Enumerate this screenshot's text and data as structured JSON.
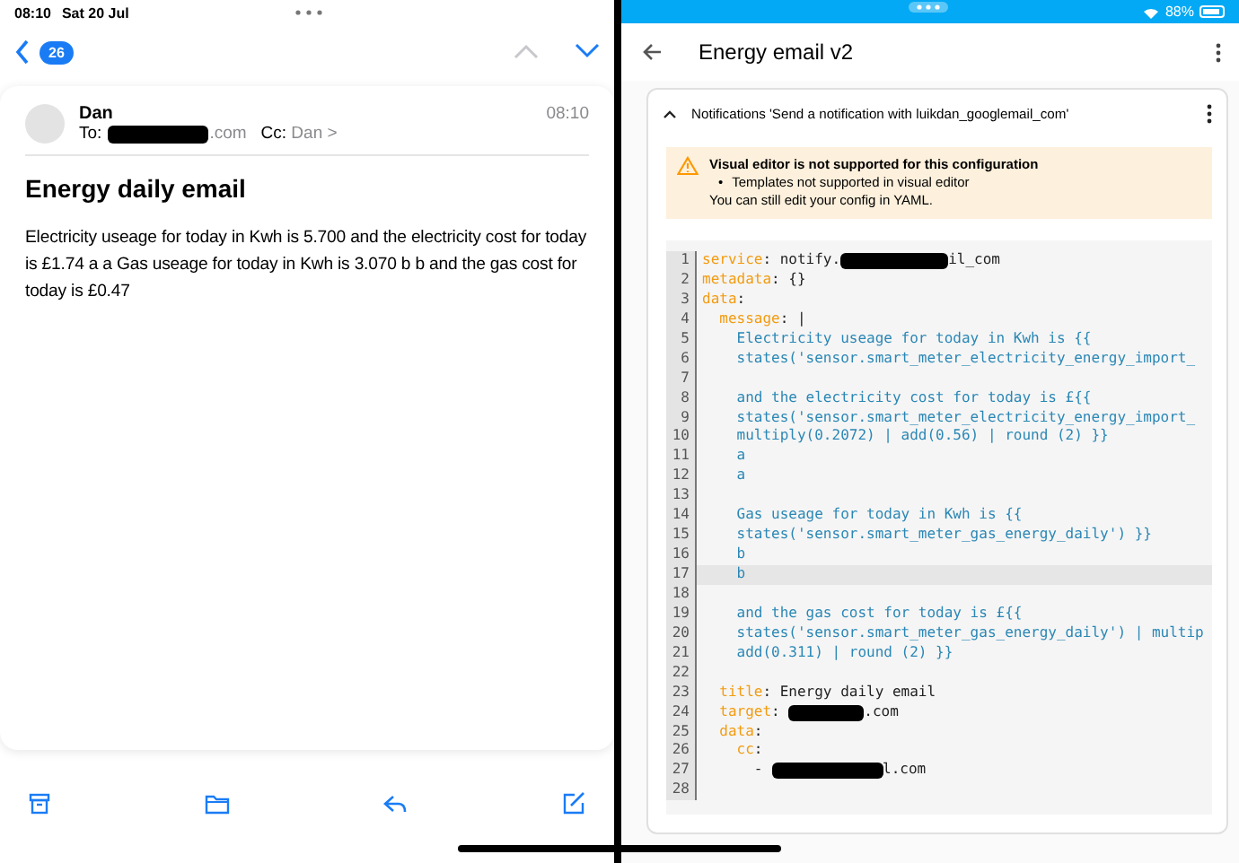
{
  "mail": {
    "status_bar": {
      "time": "08:10",
      "date": "Sat 20 Jul"
    },
    "nav": {
      "unread_count": "26",
      "previous_disabled": true,
      "next_disabled": false
    },
    "message": {
      "sender": "Dan",
      "to_label": "To:",
      "to_visible": ".com",
      "cc_label": "Cc:",
      "cc": "Dan",
      "cc_chevron": ">",
      "time": "08:10",
      "subject": "Energy daily email",
      "body": "Electricity useage for today in Kwh is 5.700 and the electricity cost for today is £1.74 a a Gas useage for today in Kwh is 3.070 b b and the gas cost for today is £0.47"
    }
  },
  "editor": {
    "status_bar": {
      "battery": "88%"
    },
    "title": "Energy email v2",
    "action": {
      "expanded": true,
      "title": "Notifications 'Send a notification with luikdan_googlemail_com'"
    },
    "warning": {
      "title": "Visual editor is not supported for this configuration",
      "bullets": [
        {
          "marker": "•",
          "text": "Templates not supported in visual editor"
        }
      ],
      "note": "You can still edit your config in YAML."
    },
    "code_lines": [
      {
        "number": "1",
        "active": false,
        "segments": [
          {
            "kind": "key",
            "text": "service"
          },
          {
            "kind": "plain",
            "text": ": notify."
          },
          {
            "kind": "redacted"
          },
          {
            "kind": "plain",
            "text": "il_com"
          }
        ]
      },
      {
        "number": "2",
        "active": false,
        "segments": [
          {
            "kind": "key",
            "text": "metadata"
          },
          {
            "kind": "plain",
            "text": ": {}"
          }
        ]
      },
      {
        "number": "3",
        "active": false,
        "segments": [
          {
            "kind": "key",
            "text": "data"
          },
          {
            "kind": "plain",
            "text": ":"
          }
        ]
      },
      {
        "number": "4",
        "active": false,
        "segments": [
          {
            "kind": "key",
            "text": "  message"
          },
          {
            "kind": "plain",
            "text": ": |"
          }
        ]
      },
      {
        "number": "5",
        "active": false,
        "segments": [
          {
            "kind": "string",
            "text": "    Electricity useage for today in Kwh is {{"
          }
        ]
      },
      {
        "number": "6",
        "active": false,
        "segments": [
          {
            "kind": "string",
            "text": "    states('sensor.smart_meter_electricity_energy_import_"
          }
        ]
      },
      {
        "number": "7",
        "active": false
      },
      {
        "number": "8",
        "active": false,
        "segments": [
          {
            "kind": "string",
            "text": "    and the electricity cost for today is £{{"
          }
        ]
      },
      {
        "number": "9",
        "active": false,
        "segments": [
          {
            "kind": "string",
            "text": "    states('sensor.smart_meter_electricity_energy_import_"
          }
        ]
      },
      {
        "number": "10",
        "active": false,
        "segments": [
          {
            "kind": "string",
            "text": "    multiply(0.2072) | add(0.56) | round (2) }}"
          }
        ]
      },
      {
        "number": "11",
        "active": false,
        "segments": [
          {
            "kind": "string",
            "text": "    a"
          }
        ]
      },
      {
        "number": "12",
        "active": false,
        "segments": [
          {
            "kind": "string",
            "text": "    a"
          }
        ]
      },
      {
        "number": "13",
        "active": false
      },
      {
        "number": "14",
        "active": false,
        "segments": [
          {
            "kind": "string",
            "text": "    Gas useage for today in Kwh is {{"
          }
        ]
      },
      {
        "number": "15",
        "active": false,
        "segments": [
          {
            "kind": "string",
            "text": "    states('sensor.smart_meter_gas_energy_daily') }}"
          }
        ]
      },
      {
        "number": "16",
        "active": false,
        "segments": [
          {
            "kind": "string",
            "text": "    b"
          }
        ]
      },
      {
        "number": "17",
        "active": true,
        "segments": [
          {
            "kind": "string",
            "text": "    b"
          }
        ]
      },
      {
        "number": "18",
        "active": false
      },
      {
        "number": "19",
        "active": false,
        "segments": [
          {
            "kind": "string",
            "text": "    and the gas cost for today is £{{"
          }
        ]
      },
      {
        "number": "20",
        "active": false,
        "segments": [
          {
            "kind": "string",
            "text": "    states('sensor.smart_meter_gas_energy_daily') | multip"
          }
        ]
      },
      {
        "number": "21",
        "active": false,
        "segments": [
          {
            "kind": "string",
            "text": "    add(0.311) | round (2) }}"
          }
        ]
      },
      {
        "number": "22",
        "active": false
      },
      {
        "number": "23",
        "active": false,
        "segments": [
          {
            "kind": "key",
            "text": "  title"
          },
          {
            "kind": "plain",
            "text": ": Energy daily email"
          }
        ]
      },
      {
        "number": "24",
        "active": false,
        "segments": [
          {
            "kind": "key",
            "text": "  target"
          },
          {
            "kind": "plain",
            "text": ": "
          },
          {
            "kind": "redacted"
          },
          {
            "kind": "plain",
            "text": ".com"
          }
        ]
      },
      {
        "number": "25",
        "active": false,
        "segments": [
          {
            "kind": "key",
            "text": "  data"
          },
          {
            "kind": "plain",
            "text": ":"
          }
        ]
      },
      {
        "number": "26",
        "active": false,
        "segments": [
          {
            "kind": "key",
            "text": "    cc"
          },
          {
            "kind": "plain",
            "text": ":"
          }
        ]
      },
      {
        "number": "27",
        "active": false,
        "segments": [
          {
            "kind": "plain",
            "text": "      - "
          },
          {
            "kind": "redacted"
          },
          {
            "kind": "plain",
            "text": "l.com"
          }
        ]
      },
      {
        "number": "28",
        "active": false
      }
    ]
  }
}
